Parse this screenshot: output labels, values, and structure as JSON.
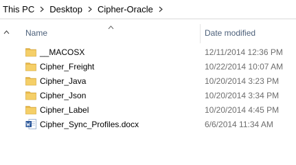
{
  "breadcrumb": [
    "This PC",
    "Desktop",
    "Cipher-Oracle"
  ],
  "columns": {
    "name": "Name",
    "date_modified": "Date modified"
  },
  "colors": {
    "folder": "#e8b84a",
    "header_text": "#4c607a",
    "date_text": "#6d6d6d",
    "word_blue": "#2b579a"
  },
  "files": [
    {
      "name": "__MACOSX",
      "date": "12/11/2014 12:36 PM",
      "icon": "folder-icon"
    },
    {
      "name": "Cipher_Freight",
      "date": "10/22/2014 10:07 AM",
      "icon": "folder-icon"
    },
    {
      "name": "Cipher_Java",
      "date": "10/20/2014 3:23 PM",
      "icon": "folder-icon"
    },
    {
      "name": "Cipher_Json",
      "date": "10/20/2014 3:34 PM",
      "icon": "folder-icon"
    },
    {
      "name": "Cipher_Label",
      "date": "10/20/2014 4:45 PM",
      "icon": "folder-icon"
    },
    {
      "name": "Cipher_Sync_Profiles.docx",
      "date": "6/6/2014 11:34 AM",
      "icon": "word-document-icon"
    }
  ]
}
